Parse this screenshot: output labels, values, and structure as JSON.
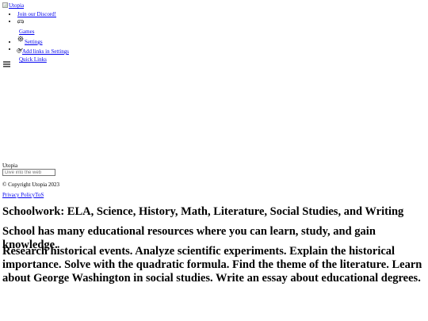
{
  "header": {
    "logo_alt": "Utopia"
  },
  "nav": {
    "items": [
      {
        "label": "Join our Discord!",
        "icon": "discord-icon"
      },
      {
        "label": "Games",
        "icon": "gamepad-icon"
      },
      {
        "label": "Settings",
        "icon": "gear-icon"
      },
      {
        "label": "Quick Links",
        "icon": "chevron-down-icon"
      }
    ],
    "quick_links_add": "Add links in Settings"
  },
  "footer": {
    "brand": "Utopia",
    "search": {
      "placeholder": "Dive into the web",
      "value": ""
    },
    "copyright": "© Copyright Utopia 2023",
    "privacy_label": "Privacy Policy",
    "tos_label": "ToS"
  },
  "content": {
    "heading1": "Schoolwork: ELA, Science, History, Math, Literature, Social Studies, and Writing",
    "heading2": "School has many educational resources where you can learn, study, and gain knowledge.",
    "heading3": "Research historical events. Analyze scientific experiments. Explain the historical importance. Solve with the quadratic formula. Find the theme of the literature. Learn about George Washington in social studies. Write an essay about educational degrees."
  },
  "colors": {
    "link": "#0000ee",
    "text": "#000000",
    "background": "#ffffff"
  }
}
